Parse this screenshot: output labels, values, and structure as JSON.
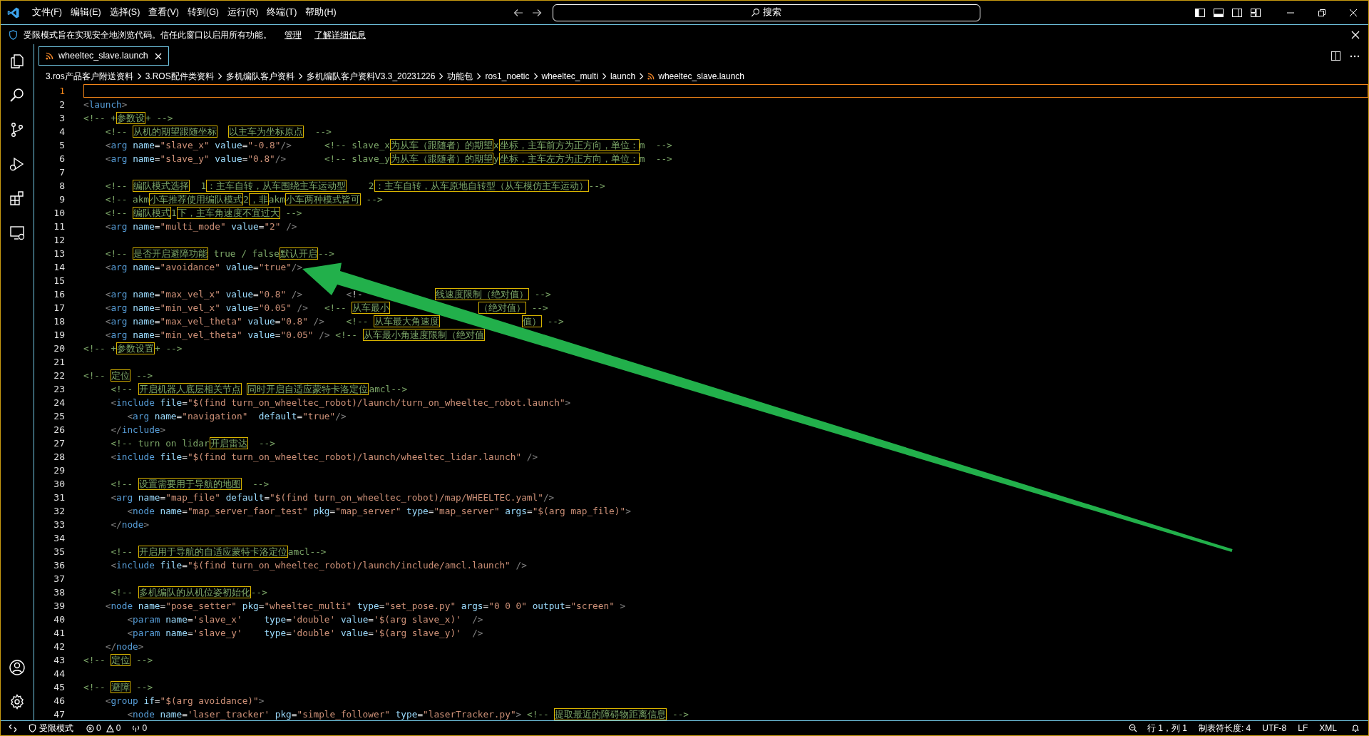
{
  "title_bar": {
    "menus": [
      "文件(F)",
      "编辑(E)",
      "选择(S)",
      "查看(V)",
      "转到(G)",
      "运行(R)",
      "终端(T)",
      "帮助(H)"
    ],
    "search_label": "搜索"
  },
  "banner": {
    "message": "受限模式旨在实现安全地浏览代码。信任此窗口以启用所有功能。",
    "links": [
      "管理",
      "了解详细信息"
    ]
  },
  "tabs": [
    {
      "label": "wheeltec_slave.launch",
      "selected": true
    }
  ],
  "breadcrumb": [
    "3.ros产品客户附送资料",
    "3.ROS配件类资料",
    "多机编队客户资料",
    "多机编队客户资料V3.3_20231226",
    "功能包",
    "ros1_noetic",
    "wheeltec_multi",
    "launch",
    "wheeltec_slave.launch"
  ],
  "editor": {
    "lines": [
      {
        "number": "1",
        "current": true
      },
      {
        "number": "2",
        "current": false,
        "text": "<launch>"
      },
      {
        "number": "3",
        "current": false,
        "text": "<!-- +参数设+ -->"
      },
      {
        "number": "4",
        "current": false,
        "text": "    <!-- 从机的期望跟随坐标  以主车为坐标原点  -->"
      },
      {
        "number": "5",
        "current": false,
        "text": "    <arg name=\"slave_x\" value=\"-0.8\"/>      <!-- slave_x为从车（跟随者）的期望x坐标，主车前方为正方向，单位：m  -->"
      },
      {
        "number": "6",
        "current": false,
        "text": "    <arg name=\"slave_y\" value=\"0.8\"/>       <!-- slave_y为从车（跟随者）的期望y坐标，主车左方为正方向，单位：m  -->"
      },
      {
        "number": "7",
        "current": false
      },
      {
        "number": "8",
        "current": false,
        "text": "    <!-- 编队模式选择  1：主车自转，从车围绕主车运动型    2：主车自转，从车原地自转型（从车模仿主车运动）-->"
      },
      {
        "number": "9",
        "current": false,
        "text": "    <!-- akm小车推荐使用编队模式2，非akm小车两种模式皆可 -->"
      },
      {
        "number": "10",
        "current": false,
        "text": "    <!-- 编队模式1下，主车角速度不宜过大 -->"
      },
      {
        "number": "11",
        "current": false,
        "text": "    <arg name=\"multi_mode\" value=\"2\" />"
      },
      {
        "number": "12",
        "current": false
      },
      {
        "number": "13",
        "current": false,
        "text": "    <!-- 是否开启避障功能 true / false默认开启-->"
      },
      {
        "number": "14",
        "current": false,
        "text": "    <arg name=\"avoidance\" value=\"true\"/>"
      },
      {
        "number": "15",
        "current": false
      },
      {
        "number": "16",
        "current": false,
        "text": "    <arg name=\"max_vel_x\" value=\"0.8\" />        <!-",
        "text_after_arrow": "线速度限制（绝对值） -->"
      },
      {
        "number": "17",
        "current": false,
        "text": "    <arg name=\"min_vel_x\" value=\"0.05\" />   <!-- 从车最小",
        "text_after_arrow": "（绝对值） -->"
      },
      {
        "number": "18",
        "current": false,
        "text": "    <arg name=\"max_vel_theta\" value=\"0.8\" />    <!-- 从车最大角速度",
        "text_after_arrow": "值） -->"
      },
      {
        "number": "19",
        "current": false,
        "text": "    <arg name=\"min_vel_theta\" value=\"0.05\" /> <!-- 从车最小角速度限制（绝对值"
      },
      {
        "number": "20",
        "current": false,
        "text": "<!-- +参数设置+ -->"
      },
      {
        "number": "21",
        "current": false
      },
      {
        "number": "22",
        "current": false,
        "text": "<!-- 定位 -->"
      },
      {
        "number": "23",
        "current": false,
        "text": "     <!-- 开启机器人底层相关节点 同时开启自适应蒙特卡洛定位amcl-->"
      },
      {
        "number": "24",
        "current": false,
        "text": "     <include file=\"$(find turn_on_wheeltec_robot)/launch/turn_on_wheeltec_robot.launch\">"
      },
      {
        "number": "25",
        "current": false,
        "text": "        <arg name=\"navigation\"  default=\"true\"/>"
      },
      {
        "number": "26",
        "current": false,
        "text": "     </include>"
      },
      {
        "number": "27",
        "current": false,
        "text": "     <!-- turn on lidar开启雷达  -->"
      },
      {
        "number": "28",
        "current": false,
        "text": "     <include file=\"$(find turn_on_wheeltec_robot)/launch/wheeltec_lidar.launch\" />"
      },
      {
        "number": "29",
        "current": false
      },
      {
        "number": "30",
        "current": false,
        "text": "     <!-- 设置需要用于导航的地图  -->"
      },
      {
        "number": "31",
        "current": false,
        "text": "     <arg name=\"map_file\" default=\"$(find turn_on_wheeltec_robot)/map/WHEELTEC.yaml\"/>"
      },
      {
        "number": "32",
        "current": false,
        "text": "        <node name=\"map_server_faor_test\" pkg=\"map_server\" type=\"map_server\" args=\"$(arg map_file)\">"
      },
      {
        "number": "33",
        "current": false,
        "text": "     </node>"
      },
      {
        "number": "34",
        "current": false
      },
      {
        "number": "35",
        "current": false,
        "text": "     <!-- 开启用于导航的自适应蒙特卡洛定位amcl-->"
      },
      {
        "number": "36",
        "current": false,
        "text": "     <include file=\"$(find turn_on_wheeltec_robot)/launch/include/amcl.launch\" />"
      },
      {
        "number": "37",
        "current": false
      },
      {
        "number": "38",
        "current": false,
        "text": "     <!-- 多机编队的从机位姿初始化-->"
      },
      {
        "number": "39",
        "current": false,
        "text": "    <node name=\"pose_setter\" pkg=\"wheeltec_multi\" type=\"set_pose.py\" args=\"0 0 0\" output=\"screen\" >"
      },
      {
        "number": "40",
        "current": false,
        "text": "        <param name='slave_x'    type='double' value='$(arg slave_x)'  />"
      },
      {
        "number": "41",
        "current": false,
        "text": "        <param name='slave_y'    type='double' value='$(arg slave_y)'  />"
      },
      {
        "number": "42",
        "current": false,
        "text": "    </node>"
      },
      {
        "number": "43",
        "current": false,
        "text": "<!-- 定位 -->"
      },
      {
        "number": "44",
        "current": false
      },
      {
        "number": "45",
        "current": false,
        "text": "<!-- 避障 -->"
      },
      {
        "number": "46",
        "current": false,
        "text": "    <group if=\"$(arg avoidance)\">"
      },
      {
        "number": "47",
        "current": false,
        "text": "        <node name='laser_tracker' pkg=\"simple_follower\" type=\"laserTracker.py\"> <!-- 提取最近的障碍物距离信息 -->"
      }
    ]
  },
  "status_bar": {
    "restricted_mode": "受限模式",
    "errors": "0",
    "warnings": "0",
    "ports": "0",
    "position": "行 1，列 1",
    "indentation": "制表符长度: 4",
    "encoding": "UTF-8",
    "line_ending": "LF",
    "language": "XML"
  }
}
